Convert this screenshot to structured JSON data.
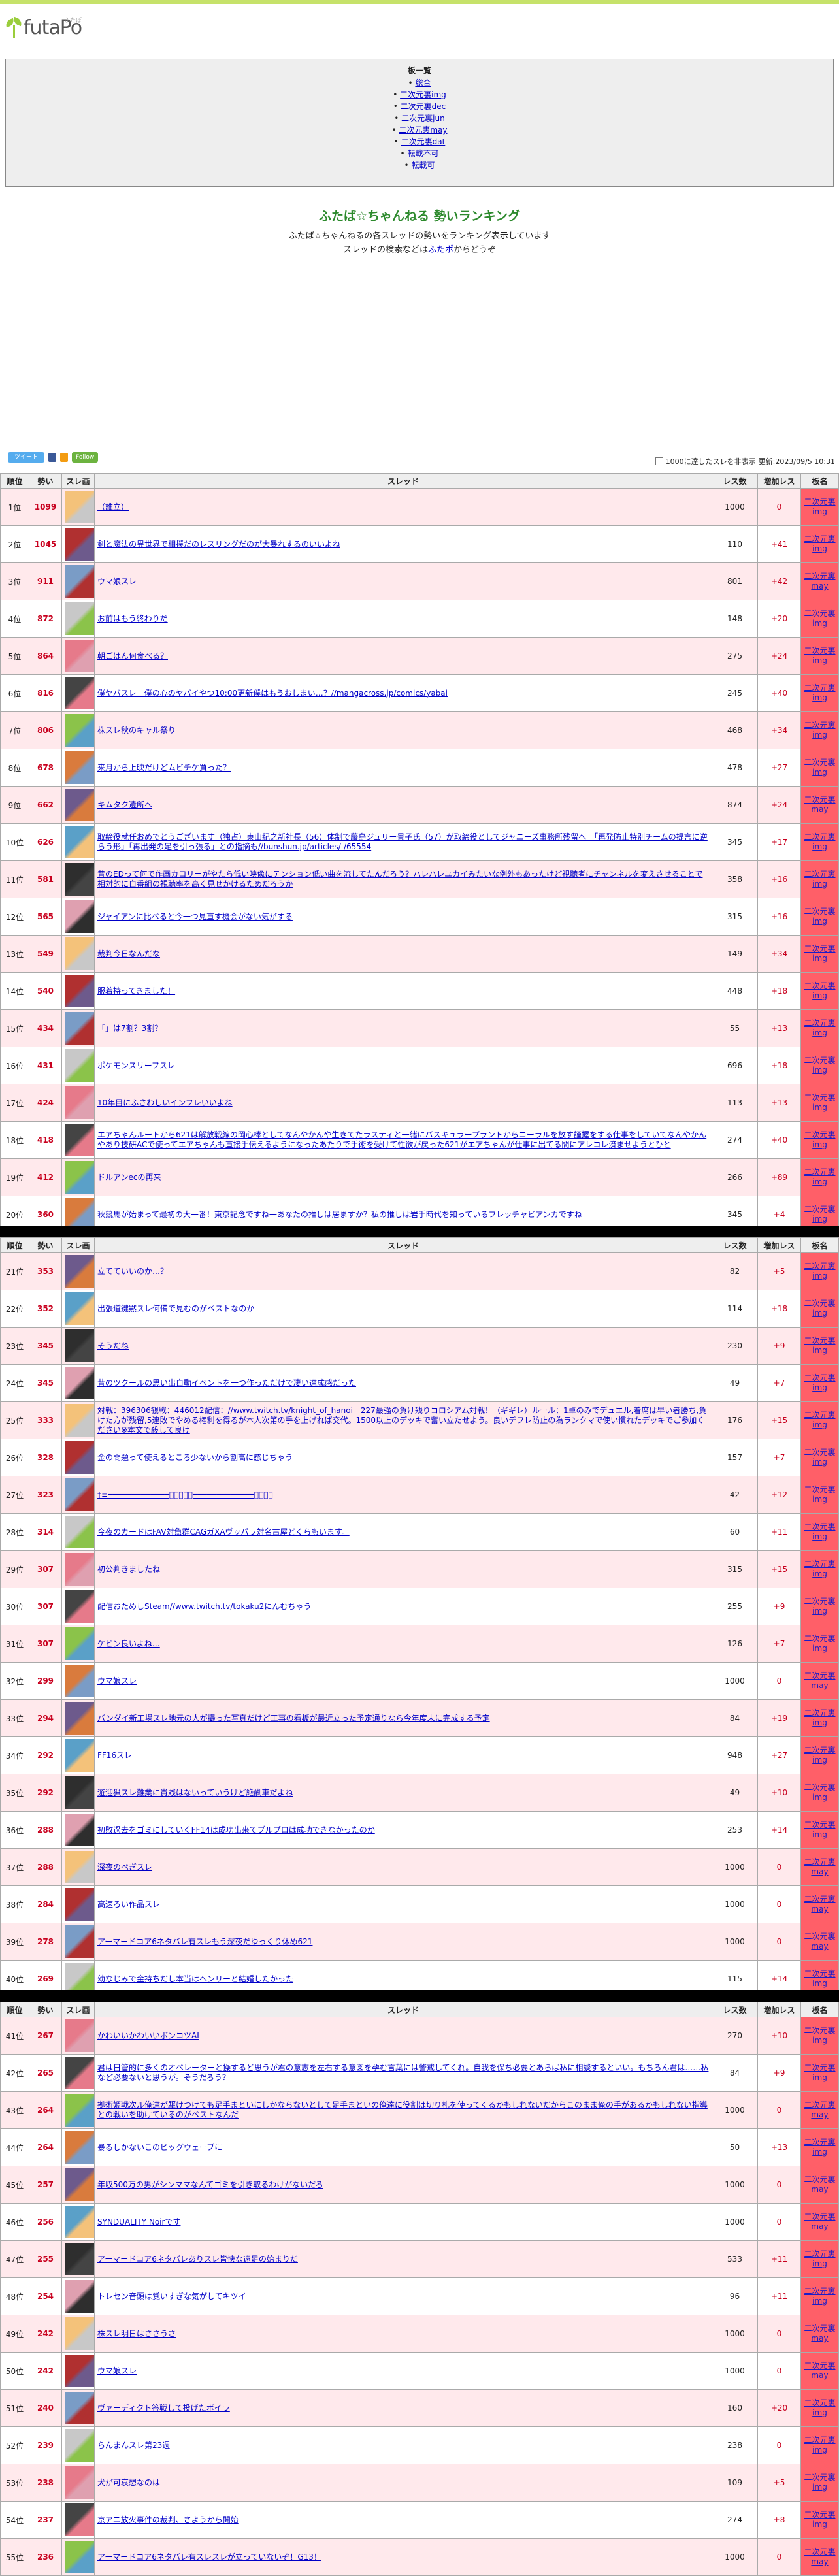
{
  "site": {
    "logo_text": "futaPo",
    "logo_sup": "ふたぽ"
  },
  "index": {
    "title": "板一覧",
    "items": [
      "総合",
      "二次元裏img",
      "二次元裏dec",
      "二次元裏jun",
      "二次元裏may",
      "二次元裏dat",
      "転載不可",
      "転載可"
    ]
  },
  "intro": {
    "title": "ふたば☆ちゃんねる 勢いランキング",
    "line1": "ふたば☆ちゃんねるの各スレッドの勢いをランキング表示しています",
    "line2_before": "スレッドの検索などは",
    "line2_link": "ふたポ",
    "line2_after": "からどうぞ"
  },
  "social": {
    "tweet": "ツイート",
    "follow": "Follow"
  },
  "controls": {
    "hide_label": "1000に達したスレを非表示",
    "updated": "更新:2023/09/5 10:31"
  },
  "table_headers": {
    "rank": "順位",
    "speed": "勢い",
    "thumb": "スレ画",
    "thread": "スレッド",
    "res": "レス数",
    "inc": "増加レス",
    "board": "板名"
  },
  "rows": [
    {
      "rank": "1位",
      "speed": "1099",
      "title": "（誰立）",
      "res": "1000",
      "inc": "0",
      "board": "二次元裏img"
    },
    {
      "rank": "2位",
      "speed": "1045",
      "title": "剣と魔法の異世界で相撲だのレスリングだのが大暴れするのいいよね",
      "res": "110",
      "inc": "+41",
      "board": "二次元裏img"
    },
    {
      "rank": "3位",
      "speed": "911",
      "title": "ウマ娘スレ",
      "res": "801",
      "inc": "+42",
      "board": "二次元裏may"
    },
    {
      "rank": "4位",
      "speed": "872",
      "title": "お前はもう終わりだ",
      "res": "148",
      "inc": "+20",
      "board": "二次元裏img"
    },
    {
      "rank": "5位",
      "speed": "864",
      "title": "朝ごはん何食べる？",
      "res": "275",
      "inc": "+24",
      "board": "二次元裏img"
    },
    {
      "rank": "6位",
      "speed": "816",
      "title": "僕ヤバスレ　僕の心のヤバイやつ10:00更新僕はもうおしまい…？//mangacross.jp/comics/yabai",
      "res": "245",
      "inc": "+40",
      "board": "二次元裏img"
    },
    {
      "rank": "7位",
      "speed": "806",
      "title": "株スレ秋のキャル祭り",
      "res": "468",
      "inc": "+34",
      "board": "二次元裏img"
    },
    {
      "rank": "8位",
      "speed": "678",
      "title": "来月から上映だけどムビチケ買った？",
      "res": "478",
      "inc": "+27",
      "board": "二次元裏img"
    },
    {
      "rank": "9位",
      "speed": "662",
      "title": "キムタク遺所へ",
      "res": "874",
      "inc": "+24",
      "board": "二次元裏may"
    },
    {
      "rank": "10位",
      "speed": "626",
      "title": "取締役就任おめでとうございます（独占）東山紀之新社長（56）体制で藤島ジュリー景子氏（57）が取締役としてジャニーズ事務所残留へ　「再発防止特別チームの提言に逆らう形」「再出発の足を引っ張る」との指摘も//bunshun.jp/articles/-/65554",
      "res": "345",
      "inc": "+17",
      "board": "二次元裏img"
    },
    {
      "rank": "11位",
      "speed": "581",
      "title": "昔のEDって何で作画カロリーがやたら低い映像にテンション低い曲を流してたんだろう？ハレハレユカイみたいな例外もあったけど視聴者にチャンネルを変えさせることで相対的に自番組の視聴率を高く見せかけるためだろうか",
      "res": "358",
      "inc": "+16",
      "board": "二次元裏img"
    },
    {
      "rank": "12位",
      "speed": "565",
      "title": "ジャイアンに比べると今一つ見直す機会がない気がする",
      "res": "315",
      "inc": "+16",
      "board": "二次元裏img"
    },
    {
      "rank": "13位",
      "speed": "549",
      "title": "裁判今日なんだな",
      "res": "149",
      "inc": "+34",
      "board": "二次元裏img"
    },
    {
      "rank": "14位",
      "speed": "540",
      "title": "服着持ってきました！",
      "res": "448",
      "inc": "+18",
      "board": "二次元裏img"
    },
    {
      "rank": "15位",
      "speed": "434",
      "title": "「」は7割？3割？",
      "res": "55",
      "inc": "+13",
      "board": "二次元裏img"
    },
    {
      "rank": "16位",
      "speed": "431",
      "title": "ポケモンスリープスレ",
      "res": "696",
      "inc": "+18",
      "board": "二次元裏img"
    },
    {
      "rank": "17位",
      "speed": "424",
      "title": "10年目にふさわしいインフレいいよね",
      "res": "113",
      "inc": "+13",
      "board": "二次元裏img"
    },
    {
      "rank": "18位",
      "speed": "418",
      "title": "エアちゃんルートから621は解放戦線の岡心棒としてなんやかんや生きてたラスティと一緒にバスキュラープラントからコーラルを放す謹握をする仕事をしていてなんやかんやあり技研ACで使ってエアちゃんも直接手伝えるようになったあたりで手術を受けて性欲が戻った621がエアちゃんが仕事に出てる間にアレコレ済ませようとひと",
      "res": "274",
      "inc": "+40",
      "board": "二次元裏img"
    },
    {
      "rank": "19位",
      "speed": "412",
      "title": "ドルアンecの再来",
      "res": "266",
      "inc": "+89",
      "board": "二次元裏img"
    },
    {
      "rank": "20位",
      "speed": "360",
      "title": "秋競馬が始まって最初の大一番！東京記念ですね一あなたの推しは居ますか？私の推しは岩手時代を知っているフレッチャビアンカですね",
      "res": "345",
      "inc": "+4",
      "board": "二次元裏img"
    },
    {
      "rank": "21位",
      "speed": "353",
      "title": "立てていいのか…？",
      "res": "82",
      "inc": "+5",
      "board": "二次元裏img"
    },
    {
      "rank": "22位",
      "speed": "352",
      "title": "出張道鍵黙スレ何備で見むのがベストなのか",
      "res": "114",
      "inc": "+18",
      "board": "二次元裏img"
    },
    {
      "rank": "23位",
      "speed": "345",
      "title": "そうだね",
      "res": "230",
      "inc": "+9",
      "board": "二次元裏img"
    },
    {
      "rank": "24位",
      "speed": "345",
      "title": "昔のツクールの思い出自動イベントを一つ作っただけで凄い達成感だった",
      "res": "49",
      "inc": "+7",
      "board": "二次元裏img"
    },
    {
      "rank": "25位",
      "speed": "333",
      "title": "対戦：396306観戦：446012配信：//www.twitch.tv/knight_of_hanoi　227最強の負け残りコロシアム対戦！（ギギレ）ルール：1卓のみでデュエル,着席は早い者勝ち,負けた方が残留,5連敗でやめる権利を得るが本人次第の手を上げれば交代。1500以上のデッキで奮い立たせよう。良いデフレ防止の為ランクマで使い慣れたデッキでご参加ください※本文で殺して良け",
      "res": "176",
      "inc": "+15",
      "board": "二次元裏img"
    },
    {
      "rank": "26位",
      "speed": "328",
      "title": "金の問題って使えるところ少ないから割高に感じちゃう",
      "res": "157",
      "inc": "+7",
      "board": "二次元裏img"
    },
    {
      "rank": "27位",
      "speed": "323",
      "title": "†≡━━━━━━━━━━━━━ﾟﾟﾟﾟﾟ━━━━━━━━━━━━━ﾟﾟﾟﾟ",
      "res": "42",
      "inc": "+12",
      "board": "二次元裏img"
    },
    {
      "rank": "28位",
      "speed": "314",
      "title": "今夜のカードはFAV対魚群CAGガXAヴッパラ対名古屋どくらもいます。",
      "res": "60",
      "inc": "+11",
      "board": "二次元裏img"
    },
    {
      "rank": "29位",
      "speed": "307",
      "title": "初公判きましたね",
      "res": "315",
      "inc": "+15",
      "board": "二次元裏img"
    },
    {
      "rank": "30位",
      "speed": "307",
      "title": "配信おためしSteam//www.twitch.tv/tokaku2にんむちゃう",
      "res": "255",
      "inc": "+9",
      "board": "二次元裏img"
    },
    {
      "rank": "31位",
      "speed": "307",
      "title": "ケビン良いよね…",
      "res": "126",
      "inc": "+7",
      "board": "二次元裏img"
    },
    {
      "rank": "32位",
      "speed": "299",
      "title": "ウマ娘スレ",
      "res": "1000",
      "inc": "0",
      "board": "二次元裏may"
    },
    {
      "rank": "33位",
      "speed": "294",
      "title": "バンダイ新工場スレ地元の人が撮った写真だけど工事の看板が最近立った予定通りなら今年度末に完成する予定",
      "res": "84",
      "inc": "+19",
      "board": "二次元裏img"
    },
    {
      "rank": "34位",
      "speed": "292",
      "title": "FF16スレ",
      "res": "948",
      "inc": "+27",
      "board": "二次元裏img"
    },
    {
      "rank": "35位",
      "speed": "292",
      "title": "遊迎猟スレ難業に貴賎はないっていうけど絶醐車だよね",
      "res": "49",
      "inc": "+10",
      "board": "二次元裏img"
    },
    {
      "rank": "36位",
      "speed": "288",
      "title": "初敗過去をゴミにしていくFF14は成功出来てブルプロは成功できなかったのか",
      "res": "253",
      "inc": "+14",
      "board": "二次元裏img"
    },
    {
      "rank": "37位",
      "speed": "288",
      "title": "深夜のぺぎスレ",
      "res": "1000",
      "inc": "0",
      "board": "二次元裏may"
    },
    {
      "rank": "38位",
      "speed": "284",
      "title": "高速ろい作品スレ",
      "res": "1000",
      "inc": "0",
      "board": "二次元裏may"
    },
    {
      "rank": "39位",
      "speed": "278",
      "title": "アーマードコア6ネタバレ有スレもう深夜だゆっくり休め621",
      "res": "1000",
      "inc": "0",
      "board": "二次元裏may"
    },
    {
      "rank": "40位",
      "speed": "269",
      "title": "幼なじみで金持ちだし本当はヘンリーと結婚したかった",
      "res": "115",
      "inc": "+14",
      "board": "二次元裏img"
    },
    {
      "rank": "41位",
      "speed": "267",
      "title": "かわいいかわいいボンコツAI",
      "res": "270",
      "inc": "+10",
      "board": "二次元裏img"
    },
    {
      "rank": "42位",
      "speed": "265",
      "title": "君は日管的に多くのオペレーターと操するど思うが君の意志を左右する意図を孕む言葉には警戒してくれ。自我を保ち必要とあらば私に相談するといい。もちろん君は……私など必要ないと思うが。そうだろう？",
      "res": "84",
      "inc": "+9",
      "board": "二次元裏img"
    },
    {
      "rank": "43位",
      "speed": "264",
      "title": "拠術姫戦次ル俺達が駆けつけても足手まといにしかならないとして足手まといの俺達に役割は切り札を使ってくるかもしれないだからこのまま俺の手があるかもしれない指導との戦いを助けているのがベストなんだ",
      "res": "1000",
      "inc": "0",
      "board": "二次元裏may"
    },
    {
      "rank": "44位",
      "speed": "264",
      "title": "暴るしかないこのビッグウェーブに",
      "res": "50",
      "inc": "+13",
      "board": "二次元裏img"
    },
    {
      "rank": "45位",
      "speed": "257",
      "title": "年収500万の男がシンママなんてゴミを引き取るわけがないだろ",
      "res": "1000",
      "inc": "0",
      "board": "二次元裏may"
    },
    {
      "rank": "46位",
      "speed": "256",
      "title": "SYNDUALITY Noirです",
      "res": "1000",
      "inc": "0",
      "board": "二次元裏may"
    },
    {
      "rank": "47位",
      "speed": "255",
      "title": "アーマードコア6ネタバレありスレ皆快な遠足の始まりだ",
      "res": "533",
      "inc": "+11",
      "board": "二次元裏img"
    },
    {
      "rank": "48位",
      "speed": "254",
      "title": "トレセン音頭は覚いすぎな気がしてキツイ",
      "res": "96",
      "inc": "+11",
      "board": "二次元裏img"
    },
    {
      "rank": "49位",
      "speed": "242",
      "title": "株スレ明日はささうさ",
      "res": "1000",
      "inc": "0",
      "board": "二次元裏may"
    },
    {
      "rank": "50位",
      "speed": "242",
      "title": "ウマ娘スレ",
      "res": "1000",
      "inc": "0",
      "board": "二次元裏may"
    },
    {
      "rank": "51位",
      "speed": "240",
      "title": "ヴァーディクト答戦して投げたボイラ",
      "res": "160",
      "inc": "+20",
      "board": "二次元裏img"
    },
    {
      "rank": "52位",
      "speed": "239",
      "title": "らんまんスレ第23週",
      "res": "238",
      "inc": "0",
      "board": "二次元裏img"
    },
    {
      "rank": "53位",
      "speed": "238",
      "title": "犬が可哀想なのは",
      "res": "109",
      "inc": "+5",
      "board": "二次元裏img"
    },
    {
      "rank": "54位",
      "speed": "237",
      "title": "京アニ放火事件の裁判、さようから開始",
      "res": "274",
      "inc": "+8",
      "board": "二次元裏img"
    },
    {
      "rank": "55位",
      "speed": "236",
      "title": "アーマードコア6ネタバレ有スレスレが立っていないぞ！G13！",
      "res": "1000",
      "inc": "0",
      "board": "二次元裏may"
    }
  ]
}
